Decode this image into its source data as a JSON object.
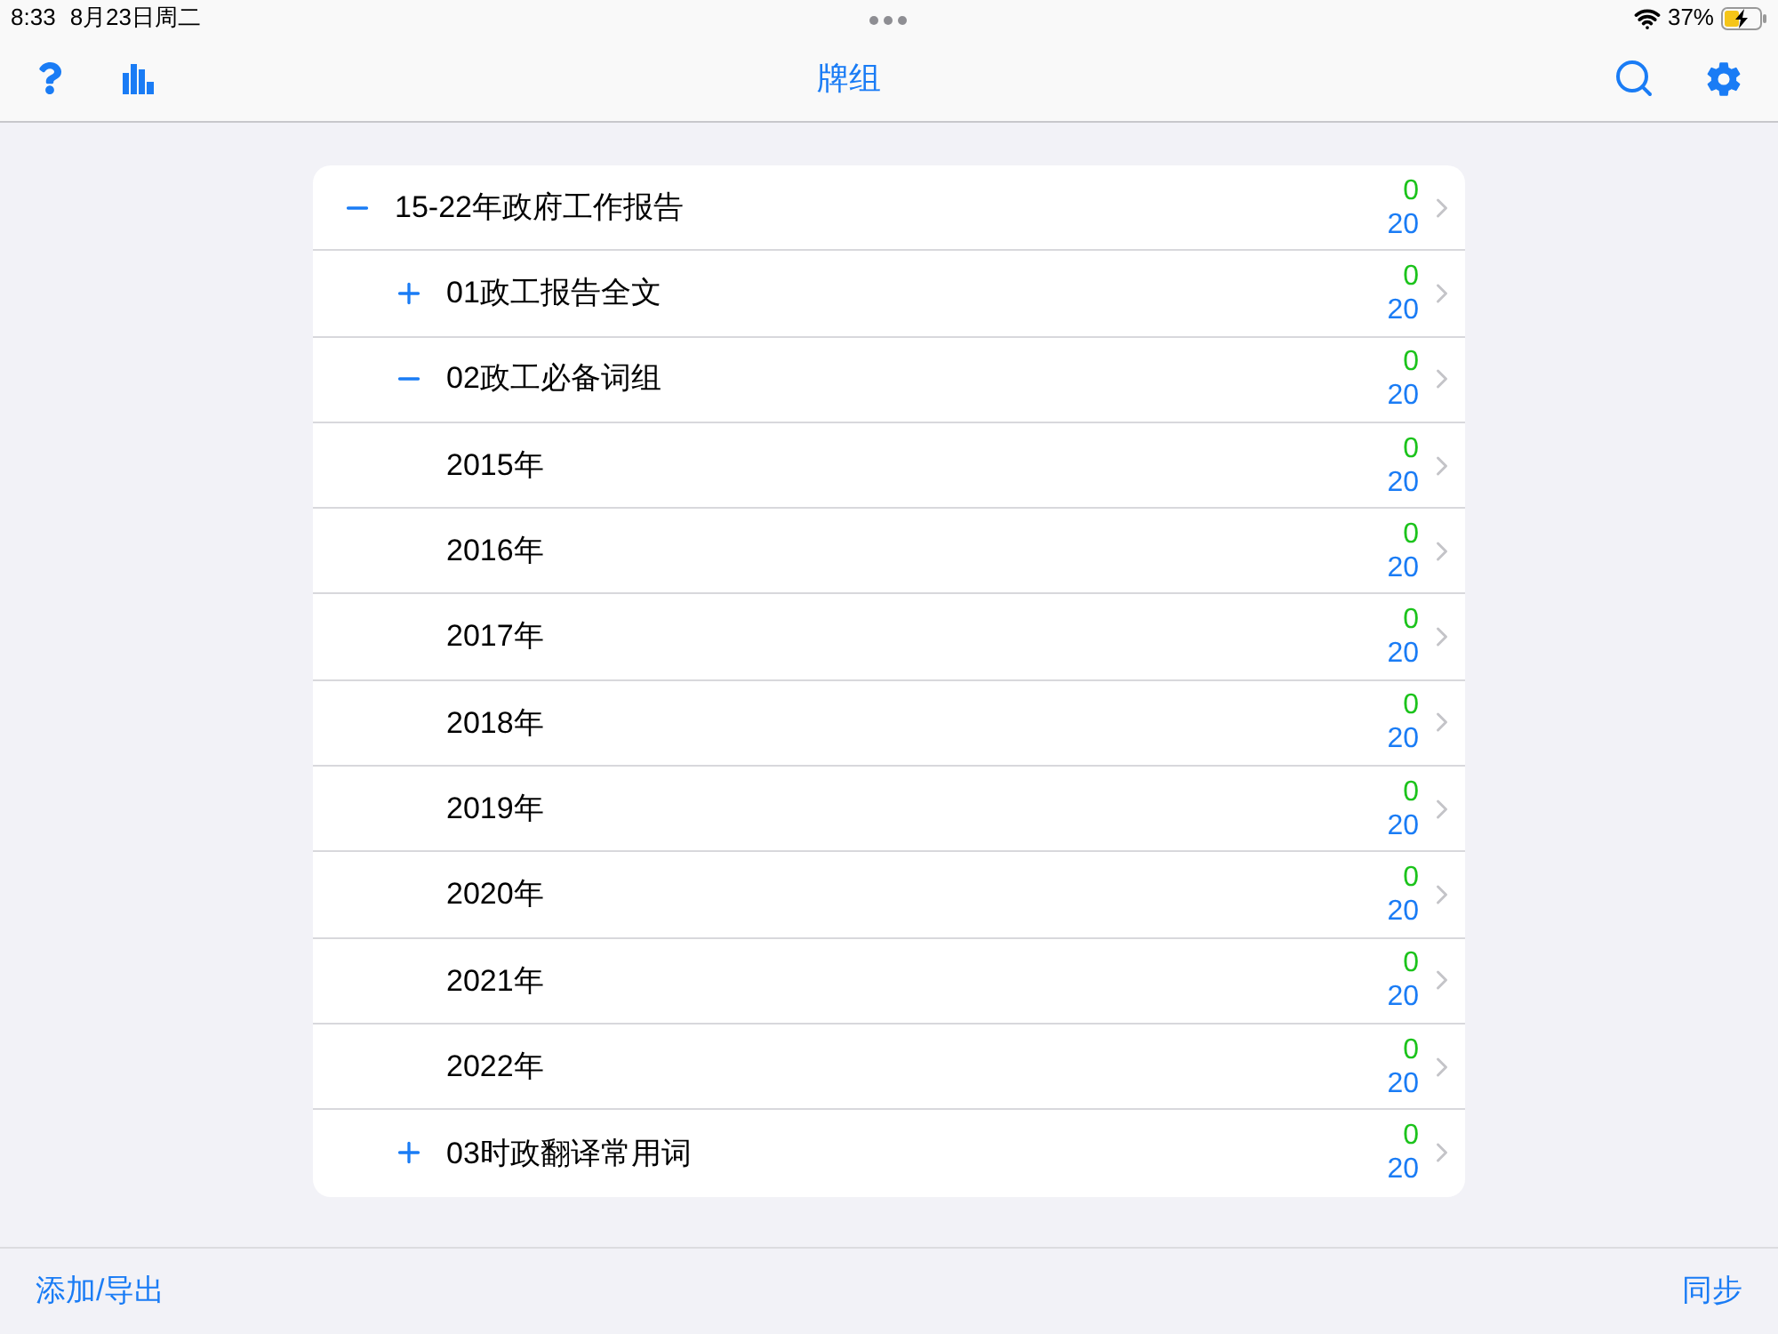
{
  "status_bar": {
    "time": "8:33",
    "date": "8月23日周二",
    "battery": "37%"
  },
  "nav": {
    "title": "牌组"
  },
  "decks": [
    {
      "name": "15-22年政府工作报告",
      "new": "0",
      "due": "20",
      "expanded": true,
      "children": [
        {
          "name": "01政工报告全文",
          "new": "0",
          "due": "20",
          "expanded": false
        },
        {
          "name": "02政工必备词组",
          "new": "0",
          "due": "20",
          "expanded": true,
          "children": [
            {
              "name": "2015年",
              "new": "0",
              "due": "20"
            },
            {
              "name": "2016年",
              "new": "0",
              "due": "20"
            },
            {
              "name": "2017年",
              "new": "0",
              "due": "20"
            },
            {
              "name": "2018年",
              "new": "0",
              "due": "20"
            },
            {
              "name": "2019年",
              "new": "0",
              "due": "20"
            },
            {
              "name": "2020年",
              "new": "0",
              "due": "20"
            },
            {
              "name": "2021年",
              "new": "0",
              "due": "20"
            },
            {
              "name": "2022年",
              "new": "0",
              "due": "20"
            }
          ]
        },
        {
          "name": "03时政翻译常用词",
          "new": "0",
          "due": "20",
          "expanded": false
        }
      ]
    }
  ],
  "footer": {
    "left": "添加/导出",
    "right": "同步"
  }
}
